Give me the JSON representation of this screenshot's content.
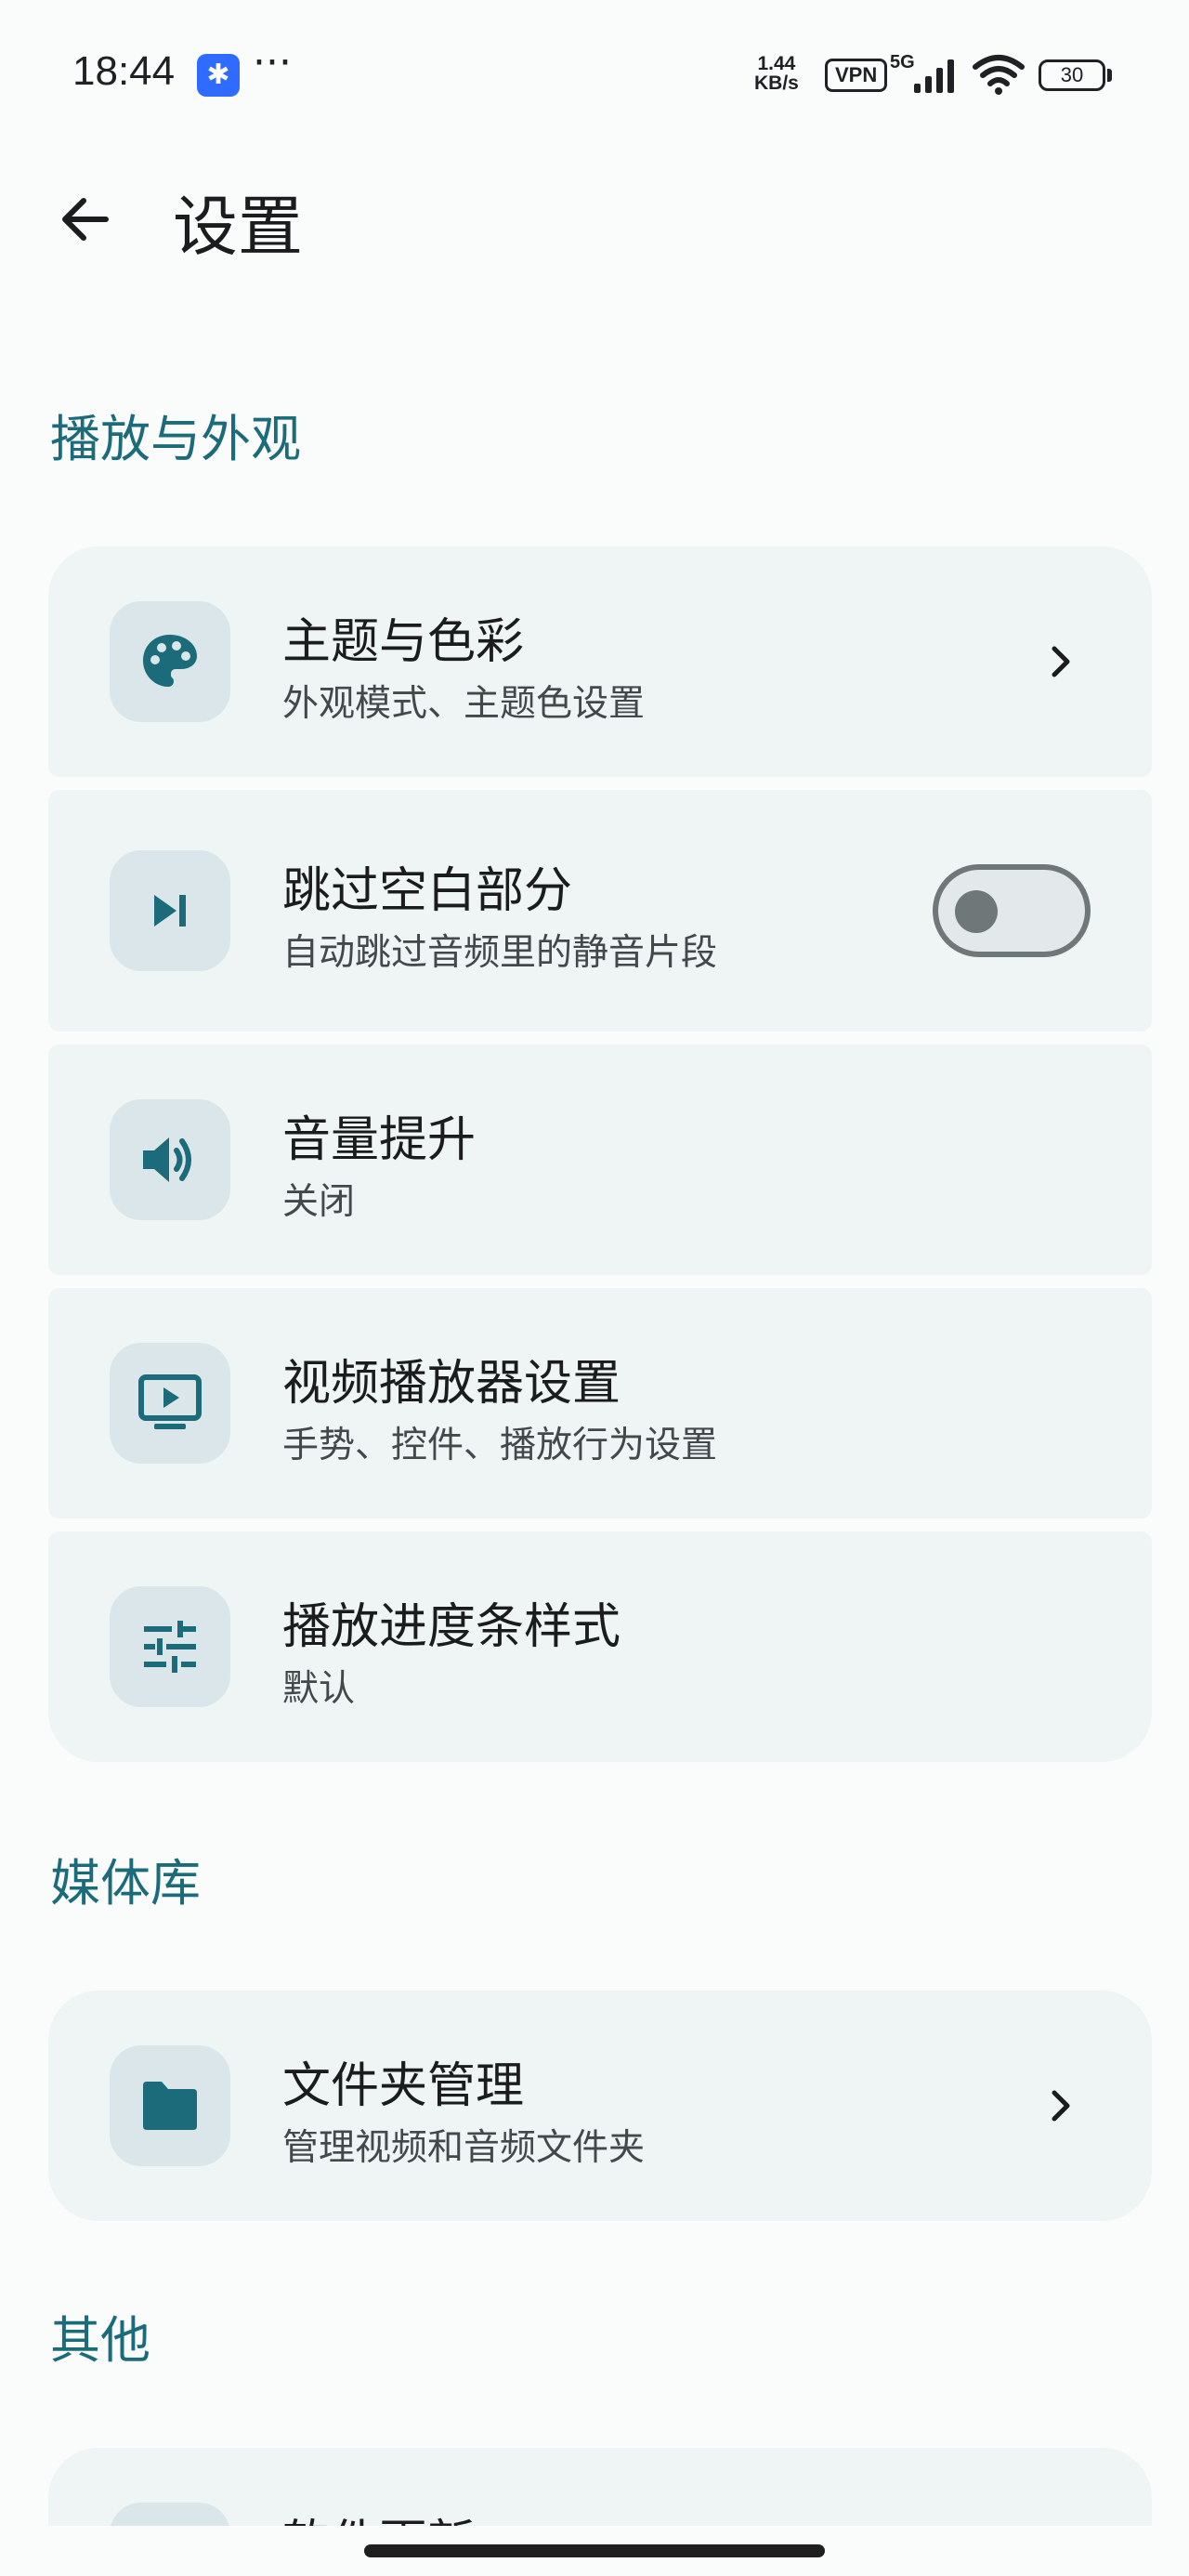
{
  "status_bar": {
    "time": "18:44",
    "app_icon_glyph": "✱",
    "overflow": "···",
    "net_speed_value": "1.44",
    "net_speed_unit": "KB/s",
    "vpn": "VPN",
    "network": "5G",
    "battery": "30"
  },
  "header": {
    "title": "设置"
  },
  "sections": {
    "playback": {
      "title": "播放与外观"
    },
    "library": {
      "title": "媒体库"
    },
    "other": {
      "title": "其他"
    }
  },
  "items": {
    "theme": {
      "title": "主题与色彩",
      "subtitle": "外观模式、主题色设置",
      "icon": "palette-icon"
    },
    "skip_silence": {
      "title": "跳过空白部分",
      "subtitle": "自动跳过音频里的静音片段",
      "icon": "skip-next-icon",
      "toggle_on": false
    },
    "volume_boost": {
      "title": "音量提升",
      "subtitle": "关闭",
      "icon": "volume-icon"
    },
    "video_player": {
      "title": "视频播放器设置",
      "subtitle": "手势、控件、播放行为设置",
      "icon": "tv-play-icon"
    },
    "progress_style": {
      "title": "播放进度条样式",
      "subtitle": "默认",
      "icon": "tune-icon"
    },
    "folders": {
      "title": "文件夹管理",
      "subtitle": "管理视频和音频文件夹",
      "icon": "folder-icon"
    },
    "update": {
      "title": "软件更新",
      "icon": "phone-icon"
    }
  },
  "colors": {
    "accent": "#1c6b7a",
    "card_bg": "#eff4f5",
    "icon_bg": "#dae6e9",
    "background": "#fafcfc"
  }
}
